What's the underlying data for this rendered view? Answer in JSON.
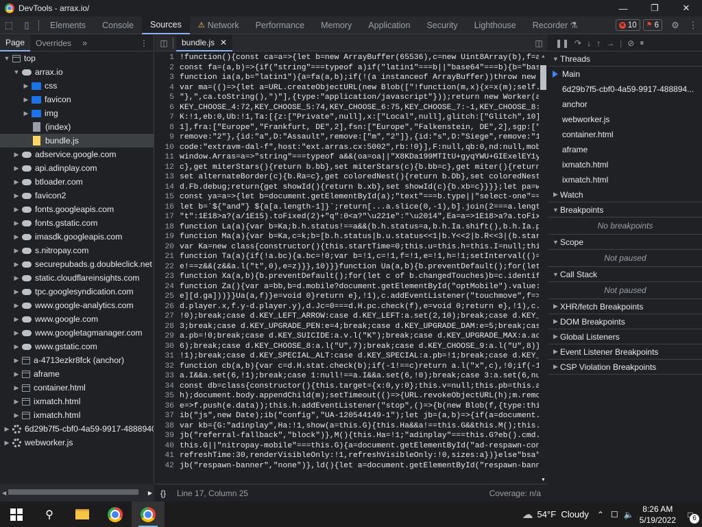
{
  "window": {
    "title": "DevTools - arrax.io/"
  },
  "toolbar": {
    "tabs": [
      "Elements",
      "Console",
      "Sources",
      "Network",
      "Performance",
      "Memory",
      "Application",
      "Security",
      "Lighthouse",
      "Recorder"
    ],
    "active_tab": "Sources",
    "errors": "10",
    "issues": "6"
  },
  "left": {
    "tabs": [
      "Page",
      "Overrides"
    ],
    "tree": [
      {
        "label": "top",
        "icon": "frame",
        "indent": 0,
        "arrow": "▼"
      },
      {
        "label": "arrax.io",
        "icon": "cloud",
        "indent": 1,
        "arrow": "▼"
      },
      {
        "label": "css",
        "icon": "folder",
        "indent": 2,
        "arrow": "▶"
      },
      {
        "label": "favicon",
        "icon": "folder",
        "indent": 2,
        "arrow": "▶"
      },
      {
        "label": "img",
        "icon": "folder",
        "indent": 2,
        "arrow": "▶"
      },
      {
        "label": "(index)",
        "icon": "file",
        "indent": 2,
        "arrow": ""
      },
      {
        "label": "bundle.js",
        "icon": "js",
        "indent": 2,
        "arrow": "",
        "selected": true
      },
      {
        "label": "adservice.google.com",
        "icon": "cloud",
        "indent": 1,
        "arrow": "▶"
      },
      {
        "label": "api.adinplay.com",
        "icon": "cloud",
        "indent": 1,
        "arrow": "▶"
      },
      {
        "label": "btloader.com",
        "icon": "cloud",
        "indent": 1,
        "arrow": "▶"
      },
      {
        "label": "favicon2",
        "icon": "cloud",
        "indent": 1,
        "arrow": "▶"
      },
      {
        "label": "fonts.googleapis.com",
        "icon": "cloud",
        "indent": 1,
        "arrow": "▶"
      },
      {
        "label": "fonts.gstatic.com",
        "icon": "cloud",
        "indent": 1,
        "arrow": "▶"
      },
      {
        "label": "imasdk.googleapis.com",
        "icon": "cloud",
        "indent": 1,
        "arrow": "▶"
      },
      {
        "label": "s.nitropay.com",
        "icon": "cloud",
        "indent": 1,
        "arrow": "▶"
      },
      {
        "label": "securepubads.g.doubleclick.net",
        "icon": "cloud",
        "indent": 1,
        "arrow": "▶"
      },
      {
        "label": "static.cloudflareinsights.com",
        "icon": "cloud",
        "indent": 1,
        "arrow": "▶"
      },
      {
        "label": "tpc.googlesyndication.com",
        "icon": "cloud",
        "indent": 1,
        "arrow": "▶"
      },
      {
        "label": "www.google-analytics.com",
        "icon": "cloud",
        "indent": 1,
        "arrow": "▶"
      },
      {
        "label": "www.google.com",
        "icon": "cloud",
        "indent": 1,
        "arrow": "▶"
      },
      {
        "label": "www.googletagmanager.com",
        "icon": "cloud",
        "indent": 1,
        "arrow": "▶"
      },
      {
        "label": "www.gstatic.com",
        "icon": "cloud",
        "indent": 1,
        "arrow": "▶"
      },
      {
        "label": "a-4713ezkr8fck (anchor)",
        "icon": "frame",
        "indent": 1,
        "arrow": "▶"
      },
      {
        "label": "aframe",
        "icon": "frame",
        "indent": 1,
        "arrow": "▶"
      },
      {
        "label": "container.html",
        "icon": "frame",
        "indent": 1,
        "arrow": "▶"
      },
      {
        "label": "ixmatch.html",
        "icon": "frame",
        "indent": 1,
        "arrow": "▶"
      },
      {
        "label": "ixmatch.html",
        "icon": "frame",
        "indent": 1,
        "arrow": "▶"
      },
      {
        "label": "6d29b7f5-cbf0-4a59-9917-4888940",
        "icon": "gear",
        "indent": 0,
        "arrow": "▶"
      },
      {
        "label": "webworker.js",
        "icon": "gear",
        "indent": 0,
        "arrow": "▶"
      }
    ]
  },
  "editor": {
    "file_tab": "bundle.js",
    "lines": [
      "!function(){const ca=a=>{let b=new ArrayBuffer(65536),c=new Uint8Array(b),f=a(",
      "const fa=(a,b)=>{if(\"string\"===typeof a)if(\"latin1\"===b||\"base64\"===b){b=\"base",
      "function ia(a,b=\"latin1\"){a=fa(a,b);if(!(a instanceof ArrayBuffer))throw new T",
      "var ma=(()=>{let a=URL.createObjectURL(new Blob([\"!function(m,x){x=x(m);self.c",
      "\"},\",ca.toString(),\")\"],{type:\"application/javascript\"}));return new Worker(a);URL.",
      "KEY_CHOOSE_4:72,KEY_CHOOSE_5:74,KEY_CHOOSE_6:75,KEY_CHOOSE_7:-1,KEY_CHOOSE_8:-",
      "K:!1,eb:0,Ub:!1,Ta:[{z:[\"Private\",null],x:[\"Local\",null],glitch:[\"Glitch\",10],",
      "1],fra:[\"Europe\",\"Frankfurt, DE\",2],fsn:[\"Europe\",\"Falkenstein, DE\",2],sgp:[\"A",
      "remove:\"2\"},{id:\"a\",D:\"Assault\",remove:[\"m\",\"2\"]},{id:\"s\",D:\"Siege\",remove:\"1\"",
      "code:\"extravm-dal-f\",host:\"ext.arras.cx:5002\",rb:!0}],F:null,qb:0,nd:null,mobi",
      "window.Arras=a=>\"string\"===typeof a&&(oa=oa||\"X8KDa199MTItU+gyqYWU+GIExelEY1yV",
      "c},get miterStars(){return b.bb},set miterStars(c){b.bb=c},get miter(){return",
      "set alternateBorder(c){b.Ra=c},get coloredNest(){return b.Db},set coloredNest(",
      "d.Fb.debug;return{get showId(){return b.xb},set showId(c){b.xb=c}}}};let pa=w",
      "const ya=a=>{let b=document.getElementById(a);\"text\"===b.type||\"select-one\"===",
      "let b=`${\"and\"} ${a[a.length-1]}`;return[...a.slice(0,-1),b].join(2===a.length",
      "\"t\":1E18>a?(a/1E15).toFixed(2)+\"q\":0<a?\"\\u221e\":\"\\u2014\",Ea=a=>1E18>a?a.toFixe",
      "function La(a){var b=Ka;b.h.status!==a&&(b.h.status=a,b.h.Ia.shift(),b.h.Ia.pu",
      "function Ma(a){var b=Ka,c=k;b=[b.h.status|b.u.status<<1|b.Y<<2|b.R<<3|(b.start",
      "var Ka=new class{constructor(){this.startTime=0;this.u=this.h=this.I=null;this",
      "function Ta(a){if(!a.bc){a.bc=!0;var b=!1,c=!1,f=!1,e=!1,h=!1;setInterval(()=>",
      "e!==z&&(z&&a.l(\"t\",0),e=z)}},10)}}function Ua(a,b){b.preventDefault();for(let",
      "function Xa(a,b){b.preventDefault();for(let c of b.changedTouches)b=c.identifi",
      "function Za(){var a=bb,b=d.mobile?document.getElementById(\"optMobile\").value:",
      "e][d.ga]))}}Ua(a,f)}e=void 0}return e},!1),c.addEventListener(\"touchmove\",f=>",
      "d.player.x,f.y-d.player.y),d.Jc=0===d.H.pc.check(f),e=void 0;return e},!1),c.a",
      "!0);break;case d.KEY_LEFT_ARROW:case d.KEY_LEFT:a.set(2,10);break;case d.KEY_F",
      "3;break;case d.KEY_UPGRADE_PEN:e=4;break;case d.KEY_UPGRADE_DAM:e=5;break;case",
      "a.pb=!0;break;case d.KEY_SUICIDE:a.v.l(\"K\");break;case d.KEY_UPGRADE_MAX:a.ac+",
      "6);break;case d.KEY_CHOOSE_8:a.l(\"U\",7);break;case d.KEY_CHOOSE_9:a.l(\"U\",8)}",
      "!1);break;case d.KEY_SPECIAL_ALT:case d.KEY_SPECIAL:a.pb=!1;break;case d.KEY_L",
      "function cb(a,b){var c=d.H.stat.check(b);if(-1!==c)return a.l(\"x\",c),!0;if(-1!",
      "a.I&&a.set(6,!1);break;case 1:null!==a.I&&a.set(6,!0);break;case 3:a.set(6,nul",
      "const db=class{constructor(){this.target={x:0,y:0};this.v=null;this.pb=this.ac",
      "h);document.body.appendChild(m);setTimeout(()=>{URL.revokeObjectURL(h);m.remov",
      "e=>f.push(e.data));this.h.addEventListener(\"stop\",()=>{b(new Blob(f,{type:thi",
      "ib(\"js\",new Date);ib(\"config\",\"UA-120544149-1\");let jb=(a,b)=>{if(a=document.ge",
      "var kb={G:\"adinplay\",Ha:!1,show(a=this.G){this.Ha&&a!==this.G&&this.M();this.H",
      "jb(\"referral-fallback\",\"block\")},M(){this.Ha=!1;\"adinplay\"===this.G?eb().cmd.c",
      "this.G||\"nitropay-mobile\"===this.G){a=document.getElementById(\"ad-respawn-cont",
      "refreshTime:30,renderVisibleOnly:!1,refreshVisibleOnly:!0,sizes:a})}else\"bsa\"=",
      "jb(\"respawn-banner\",\"none\")},ld(){let a=document.getElementById(\"respawn-banne"
    ],
    "status": {
      "braces": "{}",
      "position": "Line 17, Column 25",
      "coverage": "Coverage: n/a"
    }
  },
  "right": {
    "threads_label": "Threads",
    "threads": [
      "Main",
      "6d29b7f5-cbf0-4a59-9917-488894...",
      "anchor",
      "webworker.js",
      "container.html",
      "aframe",
      "ixmatch.html",
      "ixmatch.html"
    ],
    "watch": "Watch",
    "breakpoints": "Breakpoints",
    "no_breakpoints": "No breakpoints",
    "scope": "Scope",
    "not_paused": "Not paused",
    "call_stack": "Call Stack",
    "not_paused2": "Not paused",
    "sections": [
      "XHR/fetch Breakpoints",
      "DOM Breakpoints",
      "Global Listeners",
      "Event Listener Breakpoints",
      "CSP Violation Breakpoints"
    ]
  },
  "taskbar": {
    "weather": "54°F  Cloudy",
    "time": "8:26 AM",
    "date": "5/19/2022",
    "notifications": "6"
  }
}
